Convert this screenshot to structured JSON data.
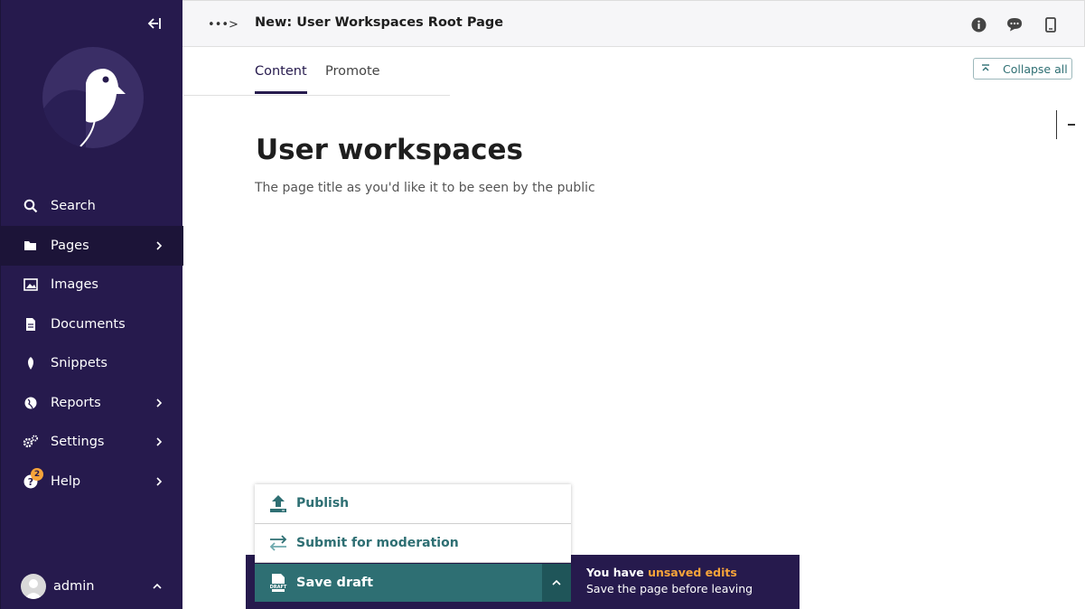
{
  "header": {
    "title": "New: User Workspaces Root Page",
    "breadcrumb_toggle": "•••>"
  },
  "sidebar": {
    "items": [
      {
        "label": "Search",
        "icon": "search-icon"
      },
      {
        "label": "Pages",
        "icon": "folder-icon",
        "active": true
      },
      {
        "label": "Images",
        "icon": "image-icon"
      },
      {
        "label": "Documents",
        "icon": "document-icon"
      },
      {
        "label": "Snippets",
        "icon": "snippet-icon"
      },
      {
        "label": "Reports",
        "icon": "globe-icon"
      },
      {
        "label": "Settings",
        "icon": "cogs-icon"
      },
      {
        "label": "Help",
        "icon": "help-icon",
        "badge": "2"
      }
    ],
    "account_name": "admin"
  },
  "tabs": [
    {
      "label": "Content",
      "active": true
    },
    {
      "label": "Promote",
      "active": false
    }
  ],
  "collapse_all_label": "Collapse all",
  "content": {
    "title_value": "User workspaces",
    "title_help": "The page title as you'd like it to be seen by the public"
  },
  "actions": {
    "publish": "Publish",
    "submit": "Submit for moderation",
    "save_draft": "Save draft"
  },
  "unsaved": {
    "prefix": "You have ",
    "highlight": "unsaved edits",
    "sub": "Save the page before leaving"
  },
  "colors": {
    "sidebar_bg": "#261a4d",
    "accent_teal": "#2e6f73",
    "highlight": "#f7a43a"
  }
}
